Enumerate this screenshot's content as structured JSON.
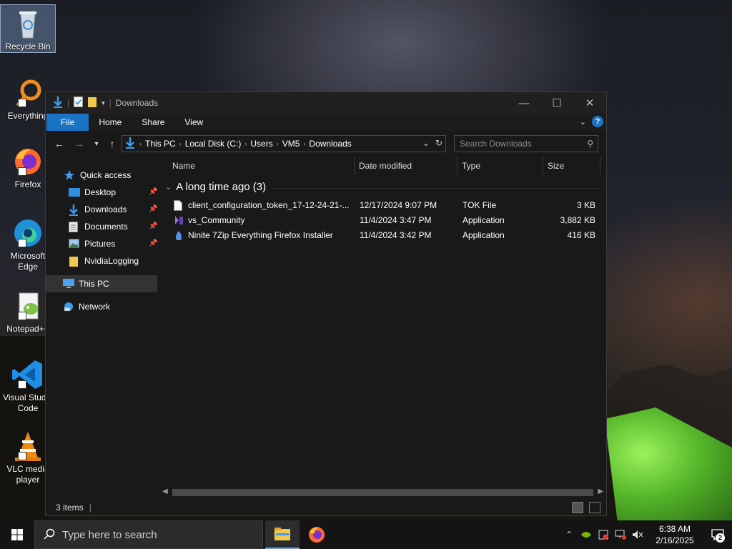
{
  "desktop": {
    "icons": [
      {
        "label": "Recycle Bin"
      },
      {
        "label": "Everything"
      },
      {
        "label": "Firefox"
      },
      {
        "label": "Microsoft Edge"
      },
      {
        "label": "Notepad++"
      },
      {
        "label": "Visual Studio Code"
      },
      {
        "label": "VLC media player"
      }
    ]
  },
  "window": {
    "title": "Downloads",
    "ribbon_tabs": [
      "File",
      "Home",
      "Share",
      "View"
    ],
    "address": {
      "crumbs": [
        "This PC",
        "Local Disk (C:)",
        "Users",
        "VM5",
        "Downloads"
      ]
    },
    "search": {
      "placeholder": "Search Downloads"
    },
    "nav_pane": {
      "quick_access": "Quick access",
      "items": [
        "Desktop",
        "Downloads",
        "Documents",
        "Pictures",
        "NvidiaLogging"
      ],
      "this_pc": "This PC",
      "network": "Network"
    },
    "columns": [
      "Name",
      "Date modified",
      "Type",
      "Size"
    ],
    "group": {
      "label": "A long time ago (3)"
    },
    "files": [
      {
        "name": "client_configuration_token_17-12-24-21-...",
        "date": "12/17/2024 9:07 PM",
        "type": "TOK File",
        "size": "3 KB"
      },
      {
        "name": "vs_Community",
        "date": "11/4/2024 3:47 PM",
        "type": "Application",
        "size": "3,882 KB"
      },
      {
        "name": "Ninite 7Zip Everything Firefox Installer",
        "date": "11/4/2024 3:42 PM",
        "type": "Application",
        "size": "416 KB"
      }
    ],
    "status": {
      "items": "3 items"
    }
  },
  "taskbar": {
    "search_placeholder": "Type here to search",
    "time": "6:38 AM",
    "date": "2/16/2025",
    "notifications": "2"
  },
  "colors": {
    "accent": "#1a73c4",
    "window_bg": "#191919",
    "taskbar_bg": "#141414"
  }
}
